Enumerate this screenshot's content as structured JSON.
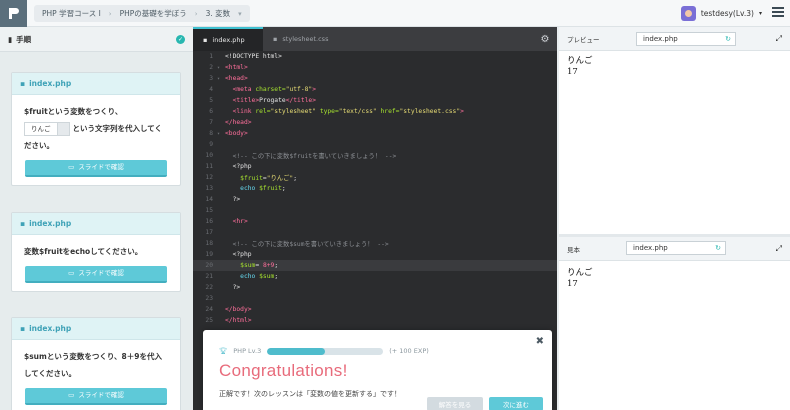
{
  "breadcrumb": {
    "course": "PHP 学習コース Ⅰ",
    "chapter": "PHPの基礎を学ぼう",
    "lesson": "3. 変数"
  },
  "user": {
    "name": "testdesy(Lv.3)"
  },
  "left_panel": {
    "title": "手順",
    "cards": [
      {
        "file": "index.php",
        "text_before": "$fruitという変数をつくり、",
        "chip": "りんご",
        "text_after": "という文字列を代入してください。",
        "button": "スライドで確認"
      },
      {
        "file": "index.php",
        "text": "変数$fruitをechoしてください。",
        "button": "スライドで確認"
      },
      {
        "file": "index.php",
        "text": "$sumという変数をつくり、8＋9を代入してください。",
        "button": "スライドで確認"
      }
    ]
  },
  "editor": {
    "tabs": [
      "index.php",
      "stylesheet.css"
    ],
    "lines": [
      {
        "n": "1",
        "parts": [
          [
            "plain",
            "<!DOCTYPE html>"
          ]
        ]
      },
      {
        "n": "2",
        "parts": [
          [
            "tag",
            "<html>"
          ]
        ]
      },
      {
        "n": "3",
        "parts": [
          [
            "tag",
            "<head>"
          ]
        ]
      },
      {
        "n": "4",
        "parts": [
          [
            "plain",
            "  "
          ],
          [
            "tag",
            "<meta "
          ],
          [
            "attr",
            "charset="
          ],
          [
            "str",
            "\"utf-8\""
          ],
          [
            "tag",
            ">"
          ]
        ]
      },
      {
        "n": "5",
        "parts": [
          [
            "plain",
            "  "
          ],
          [
            "tag",
            "<title>"
          ],
          [
            "plain",
            "Progate"
          ],
          [
            "tag",
            "</title>"
          ]
        ]
      },
      {
        "n": "6",
        "parts": [
          [
            "plain",
            "  "
          ],
          [
            "tag",
            "<link "
          ],
          [
            "attr",
            "rel="
          ],
          [
            "str",
            "\"stylesheet\" "
          ],
          [
            "attr",
            "type="
          ],
          [
            "str",
            "\"text/css\" "
          ],
          [
            "attr",
            "href="
          ],
          [
            "str",
            "\"stylesheet.css\""
          ],
          [
            "tag",
            ">"
          ]
        ]
      },
      {
        "n": "7",
        "parts": [
          [
            "tag",
            "</head>"
          ]
        ]
      },
      {
        "n": "8",
        "parts": [
          [
            "tag",
            "<body>"
          ]
        ]
      },
      {
        "n": "9",
        "parts": []
      },
      {
        "n": "10",
        "parts": [
          [
            "cm",
            "  <!-- この下に変数$fruitを書いていきましょう！ -->"
          ]
        ]
      },
      {
        "n": "11",
        "parts": [
          [
            "plain",
            "  <?php"
          ]
        ]
      },
      {
        "n": "12",
        "parts": [
          [
            "plain",
            "    "
          ],
          [
            "var",
            "$fruit"
          ],
          [
            "plain",
            "="
          ],
          [
            "str",
            "\"りんご\""
          ],
          [
            "plain",
            ";"
          ]
        ]
      },
      {
        "n": "13",
        "parts": [
          [
            "plain",
            "    "
          ],
          [
            "kw",
            "echo "
          ],
          [
            "var",
            "$fruit"
          ],
          [
            "plain",
            ";"
          ]
        ]
      },
      {
        "n": "14",
        "parts": [
          [
            "plain",
            "  ?>"
          ]
        ]
      },
      {
        "n": "15",
        "parts": []
      },
      {
        "n": "16",
        "parts": [
          [
            "plain",
            "  "
          ],
          [
            "tag",
            "<hr>"
          ]
        ]
      },
      {
        "n": "17",
        "parts": []
      },
      {
        "n": "18",
        "parts": [
          [
            "cm",
            "  <!-- この下に変数$sumを書いていきましょう！ -->"
          ]
        ]
      },
      {
        "n": "19",
        "parts": [
          [
            "plain",
            "  <?php"
          ]
        ]
      },
      {
        "n": "20",
        "parts": [
          [
            "plain",
            "    "
          ],
          [
            "var",
            "$sum"
          ],
          [
            "plain",
            "= "
          ],
          [
            "tag",
            "8+9"
          ],
          [
            "plain",
            ";"
          ]
        ]
      },
      {
        "n": "21",
        "parts": [
          [
            "plain",
            "    "
          ],
          [
            "kw",
            "echo "
          ],
          [
            "var",
            "$sum"
          ],
          [
            "plain",
            ";"
          ]
        ]
      },
      {
        "n": "22",
        "parts": [
          [
            "plain",
            "  ?>"
          ]
        ]
      },
      {
        "n": "23",
        "parts": []
      },
      {
        "n": "24",
        "parts": [
          [
            "tag",
            "</body>"
          ]
        ]
      },
      {
        "n": "25",
        "parts": [
          [
            "tag",
            "</html>"
          ]
        ]
      }
    ]
  },
  "preview_top": {
    "label": "プレビュー",
    "file": "index.php",
    "output": [
      "りんご",
      "17"
    ]
  },
  "preview_bottom": {
    "label": "見本",
    "file": "index.php",
    "output": [
      "りんご",
      "17"
    ]
  },
  "modal": {
    "level": "PHP Lv.3",
    "exp": "(+ 100 EXP)",
    "progress": 0.5,
    "title": "Congratulations!",
    "message": "正解です！次のレッスンは「変数の値を更新する」です！",
    "answer_button": "解答を見る",
    "next_button": "次に進む"
  },
  "colors": {
    "accent": "#5ec9d8",
    "congrats": "#e86b7b",
    "editor_bg": "#2b2c2e"
  }
}
